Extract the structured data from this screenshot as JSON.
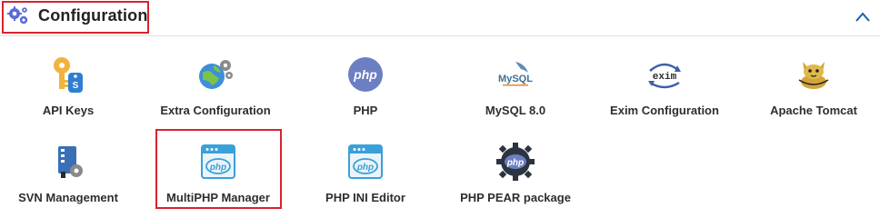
{
  "section": {
    "title": "Configuration",
    "collapse_icon": "chevron-up-icon",
    "accent_color": "#d9232e",
    "link_color": "#1a5fb4"
  },
  "items": [
    {
      "label": "API Keys",
      "icon": "api-keys-icon"
    },
    {
      "label": "Extra Configuration",
      "icon": "extra-configuration-icon"
    },
    {
      "label": "PHP",
      "icon": "php-icon"
    },
    {
      "label": "MySQL 8.0",
      "icon": "mysql-icon"
    },
    {
      "label": "Exim Configuration",
      "icon": "exim-icon"
    },
    {
      "label": "Apache Tomcat",
      "icon": "tomcat-icon"
    },
    {
      "label": "SVN Management",
      "icon": "svn-icon"
    },
    {
      "label": "MultiPHP Manager",
      "icon": "multiphp-icon"
    },
    {
      "label": "PHP INI Editor",
      "icon": "php-ini-icon"
    },
    {
      "label": "PHP PEAR package",
      "icon": "php-pear-icon"
    }
  ],
  "icon_text": {
    "php": "php",
    "mysql": "MySQL",
    "exim": "exim"
  }
}
